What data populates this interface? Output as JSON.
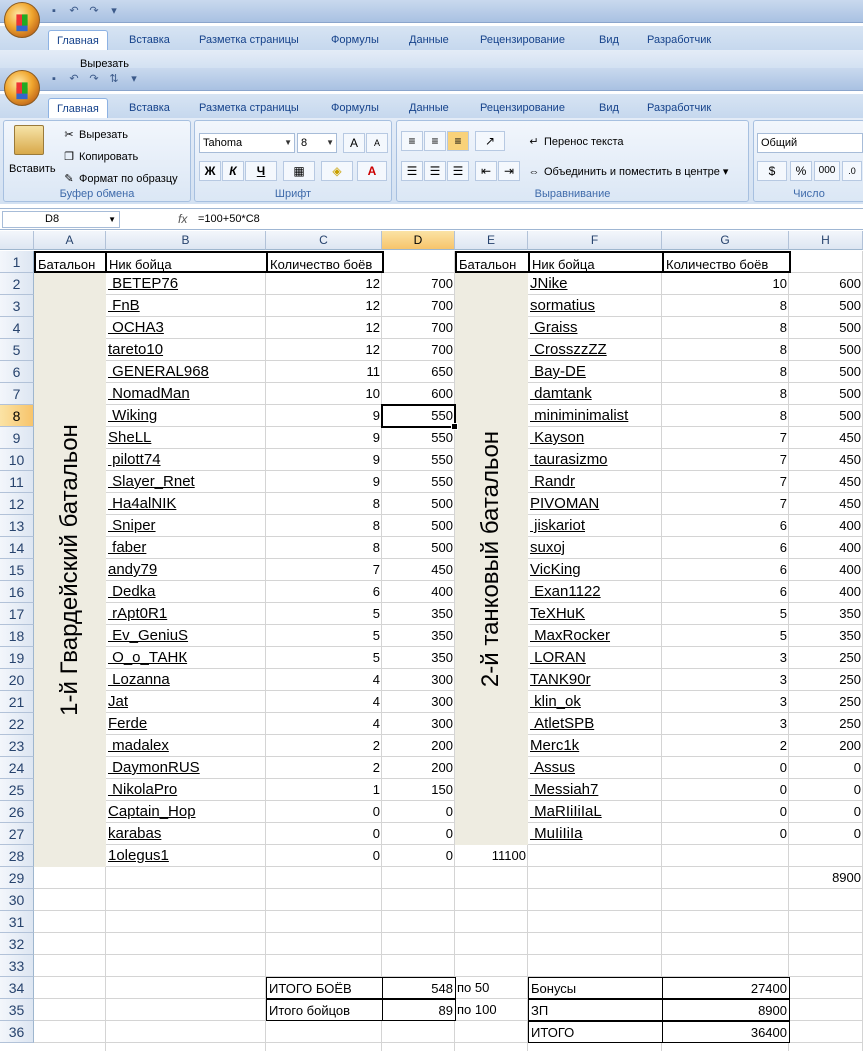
{
  "window": {
    "tabs": [
      "Главная",
      "Вставка",
      "Разметка страницы",
      "Формулы",
      "Данные",
      "Рецензирование",
      "Вид",
      "Разработчик"
    ],
    "partial_back": {
      "cut_label": "Вырезать"
    }
  },
  "ribbon": {
    "clipboard": {
      "paste": "Вставить",
      "cut": "Вырезать",
      "copy": "Копировать",
      "format_painter": "Формат по образцу",
      "group_label": "Буфер обмена"
    },
    "font": {
      "family": "Tahoma",
      "size": "8",
      "bold": "Ж",
      "italic": "К",
      "underline": "Ч",
      "grow": "A",
      "shrink": "A",
      "font_color": "A",
      "group_label": "Шрифт"
    },
    "alignment": {
      "wrap": "Перенос текста",
      "merge": "Объединить и поместить в центре",
      "group_label": "Выравнивание"
    },
    "number": {
      "format": "Общий",
      "percent": "%",
      "thousands": "000",
      "group_label": "Число"
    }
  },
  "formula_bar": {
    "name_box": "D8",
    "fx": "fx",
    "formula": "=100+50*C8"
  },
  "columns": [
    "A",
    "B",
    "C",
    "D",
    "E",
    "F",
    "G",
    "H"
  ],
  "rows": [
    "1",
    "2",
    "3",
    "4",
    "5",
    "6",
    "7",
    "8",
    "9",
    "10",
    "11",
    "12",
    "13",
    "14",
    "15",
    "16",
    "17",
    "18",
    "19",
    "20",
    "21",
    "22",
    "23",
    "24",
    "25",
    "26",
    "27",
    "28",
    "29",
    "30",
    "31",
    "32",
    "33",
    "34",
    "35",
    "36"
  ],
  "headers": {
    "battalion": "Батальон",
    "nick": "Ник бойца",
    "battles": "Количество боёв"
  },
  "battalion1": {
    "name": "1-й Гвардейский батальон",
    "rows": [
      {
        "nick": "_ВЕТЕР76",
        "battles": "12",
        "pay": "700"
      },
      {
        "nick": "_FnB",
        "battles": "12",
        "pay": "700"
      },
      {
        "nick": "_ОСНА3",
        "battles": "12",
        "pay": "700"
      },
      {
        "nick": "tareto10",
        "battles": "12",
        "pay": "700"
      },
      {
        "nick": "_GENERAL968",
        "battles": "11",
        "pay": "650"
      },
      {
        "nick": "_NomadMan",
        "battles": "10",
        "pay": "600"
      },
      {
        "nick": "_Wiking",
        "battles": "9",
        "pay": "550"
      },
      {
        "nick": "SheLL",
        "battles": "9",
        "pay": "550"
      },
      {
        "nick": "_pilott74",
        "battles": "9",
        "pay": "550"
      },
      {
        "nick": "_Slayer_Rnet",
        "battles": "9",
        "pay": "550"
      },
      {
        "nick": "_Ha4alNIK",
        "battles": "8",
        "pay": "500"
      },
      {
        "nick": "_Sniper",
        "battles": "8",
        "pay": "500"
      },
      {
        "nick": "_faber",
        "battles": "8",
        "pay": "500"
      },
      {
        "nick": "andy79",
        "battles": "7",
        "pay": "450"
      },
      {
        "nick": "_Dedka",
        "battles": "6",
        "pay": "400"
      },
      {
        "nick": "_rApt0R1",
        "battles": "5",
        "pay": "350"
      },
      {
        "nick": "_Ev_GeniuS",
        "battles": "5",
        "pay": "350"
      },
      {
        "nick": "_O_o_ТАНК",
        "battles": "5",
        "pay": "350"
      },
      {
        "nick": "_Lozanna",
        "battles": "4",
        "pay": "300"
      },
      {
        "nick": "Jat",
        "battles": "4",
        "pay": "300"
      },
      {
        "nick": "Ferde",
        "battles": "4",
        "pay": "300"
      },
      {
        "nick": "_madalex",
        "battles": "2",
        "pay": "200"
      },
      {
        "nick": "_DaymonRUS",
        "battles": "2",
        "pay": "200"
      },
      {
        "nick": "_NikolaPro",
        "battles": "1",
        "pay": "150"
      },
      {
        "nick": "Captain_Hop",
        "battles": "0",
        "pay": "0"
      },
      {
        "nick": "karabas",
        "battles": "0",
        "pay": "0"
      },
      {
        "nick": "1olegus1",
        "battles": "0",
        "pay": "0"
      }
    ],
    "sum": "11100"
  },
  "battalion2": {
    "name": "2-й танковый батальон",
    "rows": [
      {
        "nick": "JNike",
        "battles": "10",
        "pay": "600"
      },
      {
        "nick": "sormatius",
        "battles": "8",
        "pay": "500"
      },
      {
        "nick": "_Graiss",
        "battles": "8",
        "pay": "500"
      },
      {
        "nick": "_CrosszzZZ",
        "battles": "8",
        "pay": "500"
      },
      {
        "nick": "_Bay-DE",
        "battles": "8",
        "pay": "500"
      },
      {
        "nick": "_damtank",
        "battles": "8",
        "pay": "500"
      },
      {
        "nick": "_miniminimalist",
        "battles": "8",
        "pay": "500"
      },
      {
        "nick": "_Kayson",
        "battles": "7",
        "pay": "450"
      },
      {
        "nick": "_taurasizmo",
        "battles": "7",
        "pay": "450"
      },
      {
        "nick": "_Randr",
        "battles": "7",
        "pay": "450"
      },
      {
        "nick": "PIVOMAN",
        "battles": "7",
        "pay": "450"
      },
      {
        "nick": "_jiskariot",
        "battles": "6",
        "pay": "400"
      },
      {
        "nick": "suxoj",
        "battles": "6",
        "pay": "400"
      },
      {
        "nick": "VicKing",
        "battles": "6",
        "pay": "400"
      },
      {
        "nick": "_Exan1122",
        "battles": "6",
        "pay": "400"
      },
      {
        "nick": "TeXHuK",
        "battles": "5",
        "pay": "350"
      },
      {
        "nick": "_MaxRocker",
        "battles": "5",
        "pay": "350"
      },
      {
        "nick": "_LORAN",
        "battles": "3",
        "pay": "250"
      },
      {
        "nick": "TANK90r",
        "battles": "3",
        "pay": "250"
      },
      {
        "nick": "_klin_ok",
        "battles": "3",
        "pay": "250"
      },
      {
        "nick": "_AtletSPB",
        "battles": "3",
        "pay": "250"
      },
      {
        "nick": "Merc1k",
        "battles": "2",
        "pay": "200"
      },
      {
        "nick": "_Assus",
        "battles": "0",
        "pay": "0"
      },
      {
        "nick": "_Messiah7",
        "battles": "0",
        "pay": "0"
      },
      {
        "nick": "_MaRIiIiIaL",
        "battles": "0",
        "pay": "0"
      },
      {
        "nick": "_MuIiIiIa",
        "battles": "0",
        "pay": "0"
      }
    ],
    "sum": "8900"
  },
  "totals": {
    "battles_label": "ИТОГО БОЁВ",
    "battles_value": "548",
    "battles_note": "по 50",
    "fighters_label": "Итого бойцов",
    "fighters_value": "89",
    "fighters_note": "по 100",
    "bonus_label": "Бонусы",
    "bonus_value": "27400",
    "zp_label": "ЗП",
    "zp_value": "8900",
    "total_label": "ИТОГО",
    "total_value": "36400"
  },
  "colors": {
    "merge_fill": "#eeece1",
    "selected_header": "#f7c46b",
    "ribbon_text": "#15428b"
  }
}
